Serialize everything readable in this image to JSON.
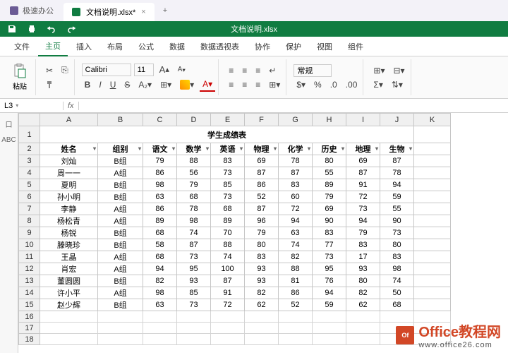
{
  "titlebar": {
    "app_name": "极速办公",
    "doc_tab": "文档说明.xlsx*",
    "new_tab": "+",
    "close": "×"
  },
  "greenbar": {
    "title": "文档说明.xlsx"
  },
  "menu": {
    "items": [
      "文件",
      "主页",
      "插入",
      "布局",
      "公式",
      "数据",
      "数据透视表",
      "协作",
      "保护",
      "视图",
      "组件"
    ],
    "active_index": 1
  },
  "ribbon": {
    "paste_label": "粘贴",
    "font_name": "Calibri",
    "font_size": "11",
    "bold": "B",
    "italic": "I",
    "underline": "U",
    "strike": "S",
    "increase_font": "A",
    "decrease_font": "A",
    "numfmt": "常规"
  },
  "namebox": "L3",
  "fx_label": "fx",
  "left_rail": [
    "口",
    "ABC"
  ],
  "chart_data": {
    "type": "table",
    "title": "学生成绩表",
    "columns": [
      "姓名",
      "组别",
      "语文",
      "数学",
      "英语",
      "物理",
      "化学",
      "历史",
      "地理",
      "生物"
    ],
    "rows": [
      [
        "刘灿",
        "B组",
        79,
        88,
        83,
        69,
        78,
        80,
        69,
        87
      ],
      [
        "周一一",
        "A组",
        86,
        56,
        73,
        87,
        87,
        55,
        87,
        78
      ],
      [
        "夏明",
        "B组",
        98,
        79,
        85,
        86,
        83,
        89,
        91,
        94
      ],
      [
        "孙小明",
        "B组",
        63,
        68,
        73,
        52,
        60,
        79,
        72,
        59
      ],
      [
        "李静",
        "A组",
        86,
        78,
        68,
        87,
        72,
        69,
        73,
        55
      ],
      [
        "杨松青",
        "A组",
        89,
        98,
        89,
        96,
        94,
        90,
        94,
        90
      ],
      [
        "杨锐",
        "B组",
        68,
        74,
        70,
        79,
        63,
        83,
        79,
        73
      ],
      [
        "滕晓珍",
        "B组",
        58,
        87,
        88,
        80,
        74,
        77,
        83,
        80
      ],
      [
        "王晶",
        "A组",
        68,
        73,
        74,
        83,
        82,
        73,
        17,
        83
      ],
      [
        "肖宏",
        "A组",
        94,
        95,
        100,
        93,
        88,
        95,
        93,
        98
      ],
      [
        "董圆圆",
        "B组",
        82,
        93,
        87,
        93,
        81,
        76,
        80,
        74
      ],
      [
        "许小平",
        "A组",
        98,
        85,
        91,
        82,
        86,
        94,
        82,
        50
      ],
      [
        "赵少辉",
        "B组",
        63,
        73,
        72,
        62,
        52,
        59,
        62,
        68
      ]
    ]
  },
  "col_letters": [
    "A",
    "B",
    "C",
    "D",
    "E",
    "F",
    "G",
    "H",
    "I",
    "J",
    "K"
  ],
  "empty_rows": [
    16,
    17,
    18
  ],
  "watermark": {
    "brand": "Office教程网",
    "url": "www.office26.com"
  }
}
